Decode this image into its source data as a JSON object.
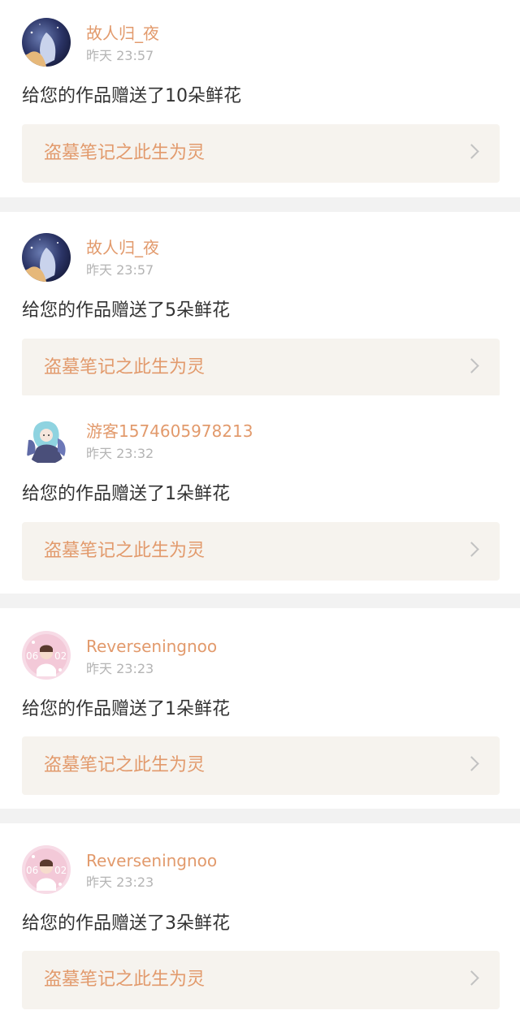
{
  "notifications": [
    {
      "username": "故人归_夜",
      "time": "昨天 23:57",
      "message": "给您的作品赠送了10朵鲜花",
      "work_title": "盗墓笔记之此生为灵",
      "avatar": "night-sky-avatar"
    },
    {
      "username": "故人归_夜",
      "time": "昨天 23:57",
      "message": "给您的作品赠送了5朵鲜花",
      "work_title": "盗墓笔记之此生为灵",
      "avatar": "night-sky-avatar"
    },
    {
      "username": "游客1574605978213",
      "time": "昨天 23:32",
      "message": "给您的作品赠送了1朵鲜花",
      "work_title": "盗墓笔记之此生为灵",
      "avatar": "anime-girl-avatar"
    },
    {
      "username": "Reverseningnoo",
      "time": "昨天 23:23",
      "message": "给您的作品赠送了1朵鲜花",
      "work_title": "盗墓笔记之此生为灵",
      "avatar": "pink-portrait-avatar"
    },
    {
      "username": "Reverseningnoo",
      "time": "昨天 23:23",
      "message": "给您的作品赠送了3朵鲜花",
      "work_title": "盗墓笔记之此生为灵",
      "avatar": "pink-portrait-avatar"
    }
  ],
  "colors": {
    "accent": "#e29a6c",
    "text": "#333333",
    "muted": "#b4b4b4",
    "link_bg": "#f6f3ee",
    "separator": "#f2f2f2"
  }
}
